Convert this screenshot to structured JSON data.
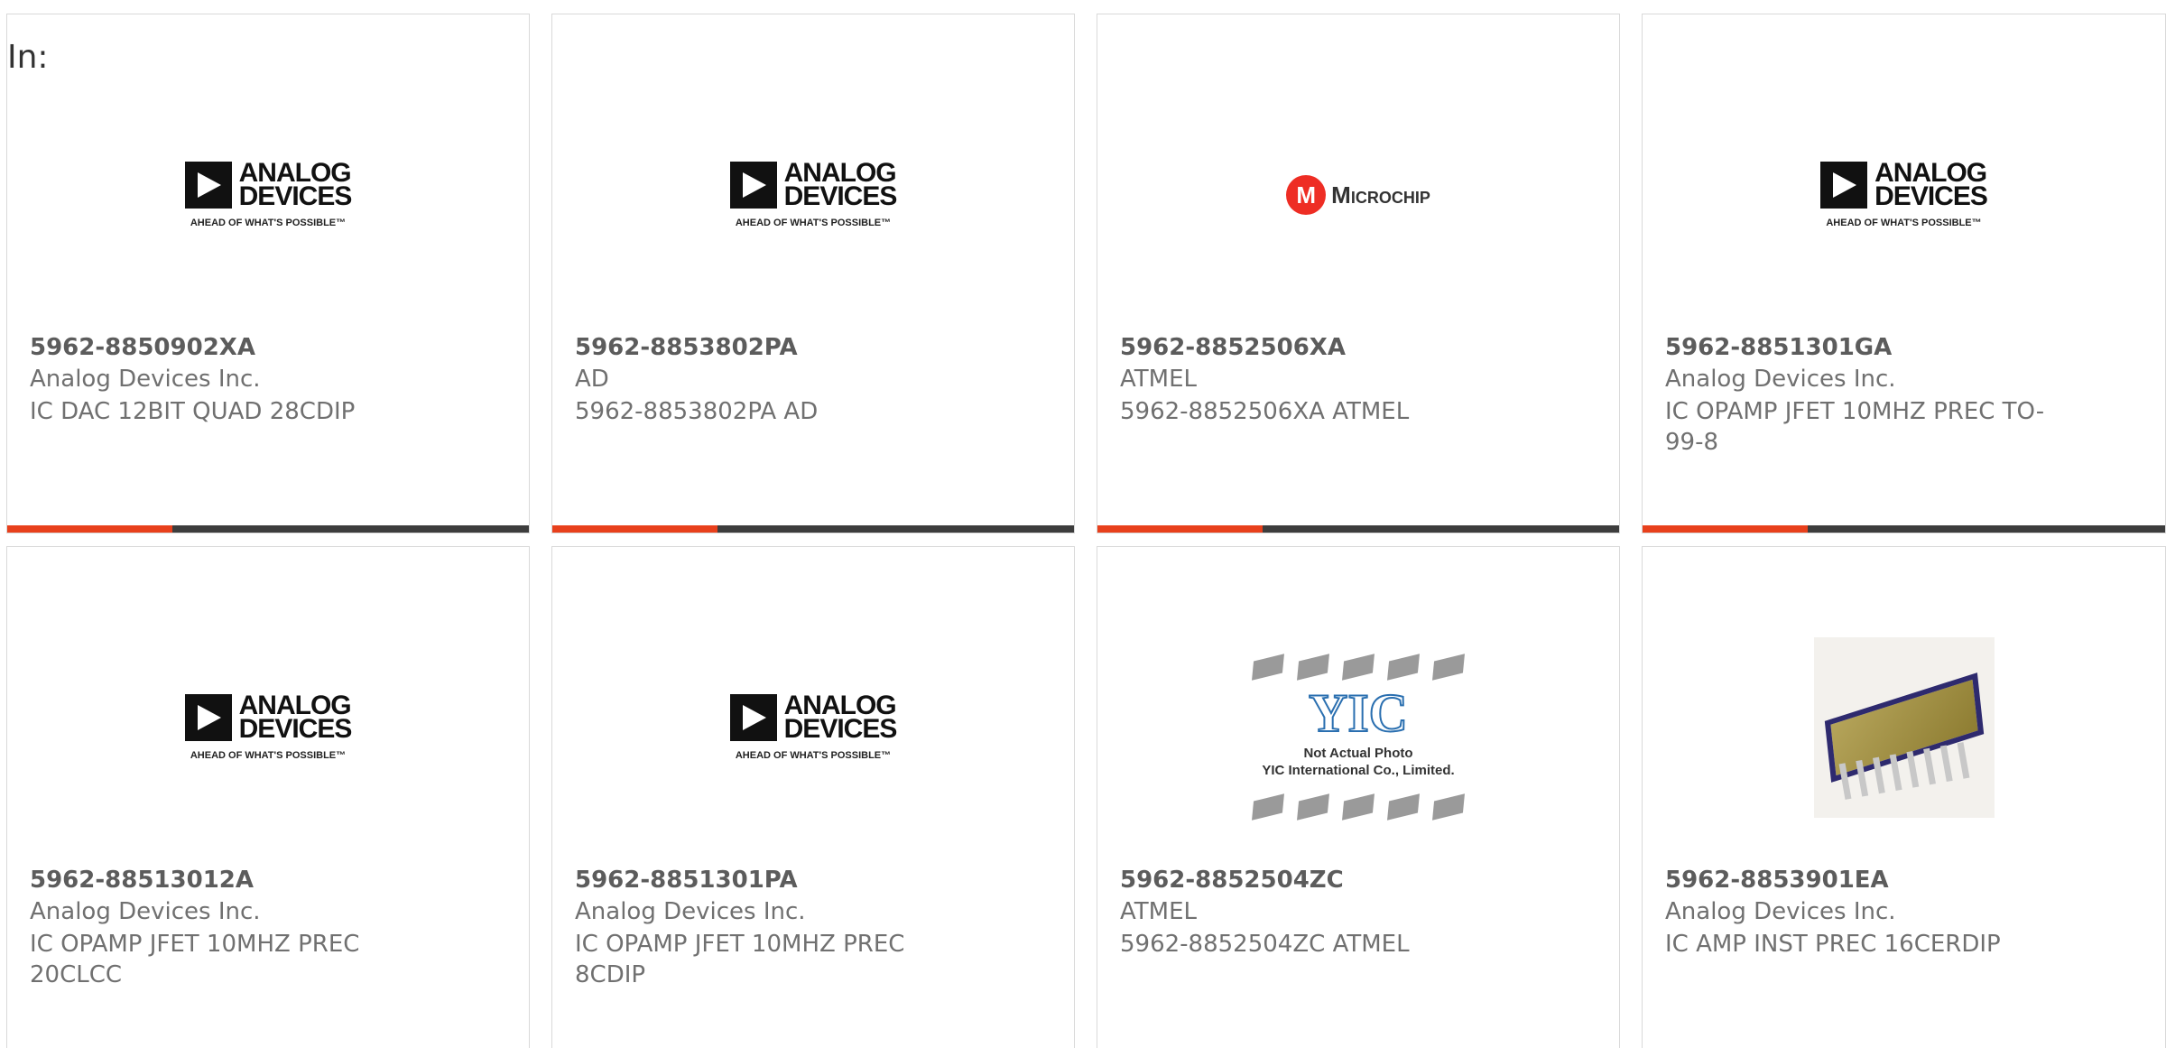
{
  "header": {
    "in_label": "In:"
  },
  "accent_color": "#e8401c",
  "bar_color": "#3d3d3d",
  "logos": {
    "analog_devices": {
      "line1": "ANALOG",
      "line2": "DEVICES",
      "tagline": "AHEAD OF WHAT'S POSSIBLE™"
    },
    "microchip": {
      "word": "Microchip",
      "mark": "M"
    },
    "yic": {
      "mark": "YIC",
      "line1": "Not Actual Photo",
      "line2": "YIC International Co., Limited."
    }
  },
  "products": [
    {
      "part_number": "5962-8850902XA",
      "manufacturer": "Analog Devices Inc.",
      "description": "IC DAC 12BIT QUAD 28CDIP",
      "logo": "analog-devices"
    },
    {
      "part_number": "5962-8853802PA",
      "manufacturer": "AD",
      "description": "5962-8853802PA AD",
      "logo": "analog-devices"
    },
    {
      "part_number": "5962-8852506XA",
      "manufacturer": "ATMEL",
      "description": "5962-8852506XA ATMEL",
      "logo": "microchip"
    },
    {
      "part_number": "5962-8851301GA",
      "manufacturer": "Analog Devices Inc.",
      "description": "IC OPAMP JFET 10MHZ PREC TO-99-8",
      "logo": "analog-devices"
    },
    {
      "part_number": "5962-88513012A",
      "manufacturer": "Analog Devices Inc.",
      "description": "IC OPAMP JFET 10MHZ PREC 20CLCC",
      "logo": "analog-devices"
    },
    {
      "part_number": "5962-8851301PA",
      "manufacturer": "Analog Devices Inc.",
      "description": "IC OPAMP JFET 10MHZ PREC 8CDIP",
      "logo": "analog-devices"
    },
    {
      "part_number": "5962-8852504ZC",
      "manufacturer": "ATMEL",
      "description": "5962-8852504ZC ATMEL",
      "logo": "yic-placeholder"
    },
    {
      "part_number": "5962-8853901EA",
      "manufacturer": "Analog Devices Inc.",
      "description": "IC AMP INST PREC 16CERDIP",
      "logo": "dip-photo"
    }
  ]
}
